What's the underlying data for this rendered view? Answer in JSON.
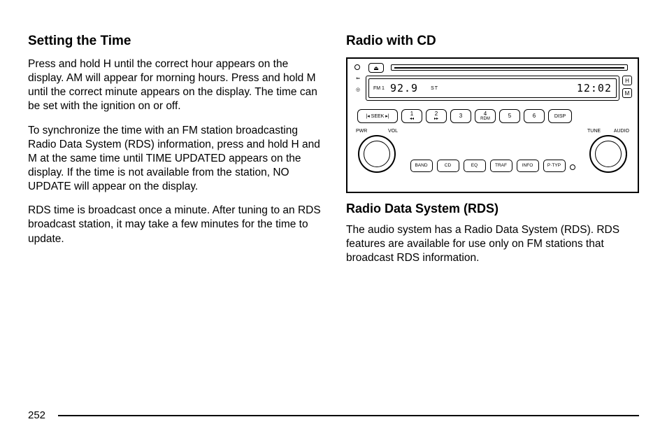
{
  "left": {
    "heading": "Setting the Time",
    "p1": "Press and hold H until the correct hour appears on the display. AM will appear for morning hours. Press and hold M until the correct minute appears on the display. The time can be set with the ignition on or off.",
    "p2": "To synchronize the time with an FM station broadcasting Radio Data System (RDS) information, press and hold H and M at the same time until TIME UPDATED appears on the display. If the time is not available from the station, NO UPDATE will appear on the display.",
    "p3": "RDS time is broadcast once a minute. After tuning to an RDS broadcast station, it may take a few minutes for the time to update."
  },
  "right": {
    "heading": "Radio with CD",
    "rds_heading": "Radio Data System (RDS)",
    "rds_p1": "The audio system has a Radio Data System (RDS). RDS features are available for use only on FM stations that broadcast RDS information."
  },
  "radio": {
    "eject": "⏏",
    "band": "FM 1",
    "freq": "92.9",
    "stereo": "ST",
    "clock": "12:02",
    "h": "H",
    "m": "M",
    "seek": "SEEK",
    "presets": [
      {
        "num": "1",
        "sub": "◂◂"
      },
      {
        "num": "2",
        "sub": "▸▸"
      },
      {
        "num": "3",
        "sub": ""
      },
      {
        "num": "4",
        "sub": "RDM"
      },
      {
        "num": "5",
        "sub": ""
      },
      {
        "num": "6",
        "sub": ""
      }
    ],
    "disp": "DISP",
    "pwr": "PWR",
    "vol": "VOL",
    "tune": "TUNE",
    "audio": "AUDIO",
    "mid": [
      "BAND",
      "CD",
      "EQ",
      "TRAF",
      "INFO",
      "P·TYP"
    ]
  },
  "page": "252"
}
